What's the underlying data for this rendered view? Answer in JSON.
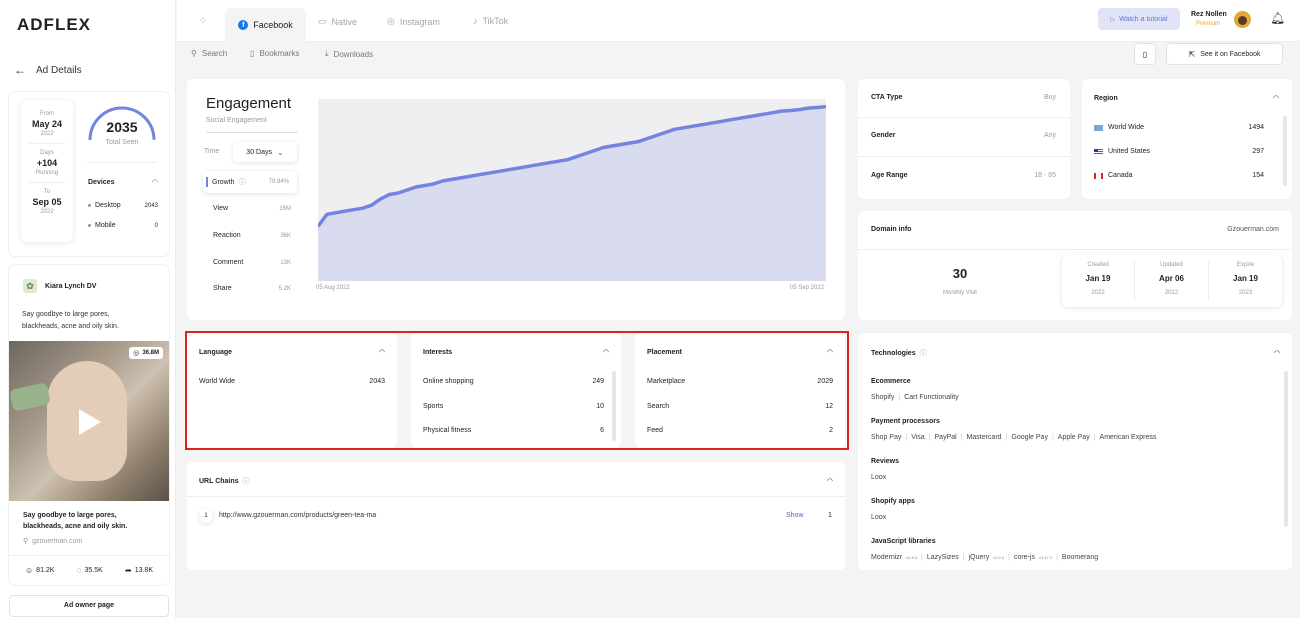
{
  "brand": "ADFLEX",
  "nav": {
    "tabs": [
      {
        "label": "Facebook"
      },
      {
        "label": "Native"
      },
      {
        "label": "Instagram"
      },
      {
        "label": "TikTok"
      }
    ],
    "watch_tutorial": "Watch a tutorial",
    "user_name": "Rez Nollen",
    "user_plan": "Premium"
  },
  "subnav": {
    "search": "Search",
    "bookmarks": "Bookmarks",
    "downloads": "Downloads",
    "see_on_facebook": "See it on Facebook"
  },
  "sidebar": {
    "back_label": "Ad Details",
    "dates": {
      "from_label": "From",
      "from_date": "May 24",
      "from_year": "2022",
      "days_label": "Days",
      "days_value": "+104",
      "days_status": "Running",
      "to_label": "To",
      "to_date": "Sep 05",
      "to_year": "2022"
    },
    "total_seen": {
      "value": "2035",
      "label": "Total Seen"
    },
    "devices": {
      "title": "Devices",
      "items": [
        {
          "label": "Desktop",
          "value": "2043"
        },
        {
          "label": "Mobile",
          "value": "0"
        }
      ]
    },
    "post": {
      "author": "Kiara Lynch DV",
      "text": "Say goodbye to large pores, blackheads, acne and oily skin.",
      "views": "36.8M",
      "caption": "Say goodbye to large pores, blackheads, acne and oily skin.",
      "domain": "gzouerman.com",
      "stats": {
        "reactions": "81.2K",
        "comments": "35.5K",
        "shares": "13.8K"
      }
    },
    "owner_page_button": "Ad owner page"
  },
  "engagement": {
    "title": "Engagement",
    "subtitle": "Social Engagement",
    "time_label": "Time",
    "time_value": "30 Days",
    "metrics": [
      {
        "label": "Growth",
        "value": "79.84%"
      },
      {
        "label": "View",
        "value": "16M"
      },
      {
        "label": "Reaction",
        "value": "36K"
      },
      {
        "label": "Comment",
        "value": "13K"
      },
      {
        "label": "Share",
        "value": "5.2K"
      }
    ],
    "x_start": "05 Aug 2022",
    "x_end": "05 Sep 2022"
  },
  "chart_data": {
    "type": "area",
    "x": [
      "05 Aug 2022",
      "05 Sep 2022"
    ],
    "series": [
      {
        "values": [
          18,
          22,
          22.5,
          23,
          23.5,
          24,
          25,
          27,
          28.5,
          29,
          30,
          31,
          31.5,
          32,
          33,
          33.5,
          34,
          34.5,
          35,
          35.5,
          36,
          36.5,
          37,
          37.5,
          38,
          38.5,
          39,
          39.5,
          40,
          41,
          42,
          43,
          44,
          44.5,
          45,
          45.5,
          46,
          47,
          48,
          49,
          50,
          50.5,
          51,
          51.5,
          52,
          52.5,
          53,
          53.5,
          54,
          54.5,
          55,
          55.5,
          56,
          56.2,
          56.5,
          57,
          57.2,
          57.5
        ]
      }
    ],
    "ylim": [
      0,
      60
    ],
    "grid": false,
    "color": "#7284e0"
  },
  "targeting": {
    "cta_label": "CTA Type",
    "cta_value": "Buy",
    "gender_label": "Gender",
    "gender_value": "Any",
    "age_label": "Age Range",
    "age_value": "18 - 65"
  },
  "region": {
    "title": "Region",
    "items": [
      {
        "flag": "world",
        "label": "World Wide",
        "value": "1494"
      },
      {
        "flag": "us",
        "label": "United States",
        "value": "297"
      },
      {
        "flag": "ca",
        "label": "Canada",
        "value": "154"
      }
    ]
  },
  "domain_info": {
    "title": "Domain info",
    "domain": "Gzouerman.com",
    "monthly_visit": "30",
    "monthly_visit_label": "Monthly Visit",
    "created_label": "Created",
    "created_date": "Jan 19",
    "created_year": "2022",
    "updated_label": "Updated",
    "updated_date": "Apr 06",
    "updated_year": "2022",
    "expire_label": "Expire",
    "expire_date": "Jan 19",
    "expire_year": "2023"
  },
  "language": {
    "title": "Language",
    "items": [
      {
        "label": "World Wide",
        "value": "2043"
      }
    ]
  },
  "interests": {
    "title": "Interests",
    "items": [
      {
        "label": "Online shopping",
        "value": "249"
      },
      {
        "label": "Sports",
        "value": "10"
      },
      {
        "label": "Physical fitness",
        "value": "6"
      }
    ]
  },
  "placement": {
    "title": "Placement",
    "items": [
      {
        "label": "Marketplace",
        "value": "2029"
      },
      {
        "label": "Search",
        "value": "12"
      },
      {
        "label": "Feed",
        "value": "2"
      }
    ]
  },
  "url_chains": {
    "title": "URL Chains",
    "items": [
      {
        "index": "1",
        "url": "http://www.gzouerman.com/products/green-tea-ma",
        "action": "Show",
        "count": "1"
      }
    ]
  },
  "technologies": {
    "title": "Technologies",
    "groups": [
      {
        "title": "Ecommerce",
        "items": [
          {
            "name": "Shopify"
          },
          {
            "name": "Cart Functionality"
          }
        ]
      },
      {
        "title": "Payment processors",
        "items": [
          {
            "name": "Shop Pay"
          },
          {
            "name": "Visa"
          },
          {
            "name": "PayPal"
          },
          {
            "name": "Mastercard"
          },
          {
            "name": "Google Pay"
          },
          {
            "name": "Apple Pay"
          },
          {
            "name": "American Express"
          }
        ]
      },
      {
        "title": "Reviews",
        "items": [
          {
            "name": "Loox"
          }
        ]
      },
      {
        "title": "Shopify apps",
        "items": [
          {
            "name": "Loox"
          }
        ]
      },
      {
        "title": "JavaScript libraries",
        "items": [
          {
            "name": "Modernizr",
            "version": "v2.8.3"
          },
          {
            "name": "LazySizes"
          },
          {
            "name": "jQuery",
            "version": "v2.2.4"
          },
          {
            "name": "core-js",
            "version": "v3.17.2"
          },
          {
            "name": "Boomerang"
          }
        ]
      }
    ]
  },
  "colors": {
    "accent": "#7284e0",
    "highlight_border": "#d22",
    "premium": "#e3a73a"
  }
}
